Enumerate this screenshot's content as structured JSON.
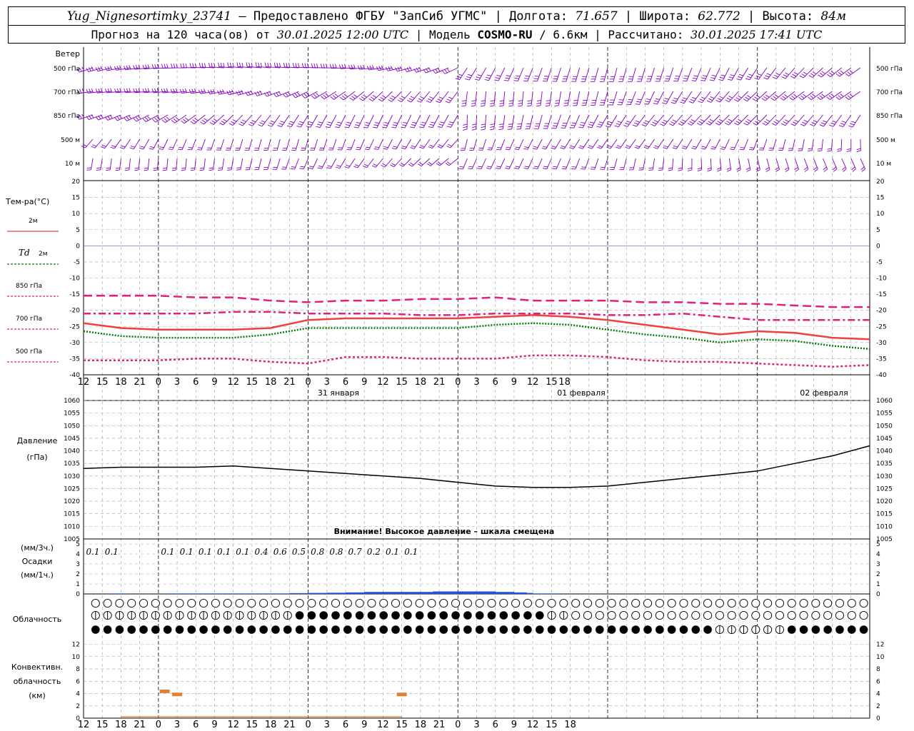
{
  "header": {
    "station": "Yug_Nignesortimky_23741",
    "provided_by": "— Предоставлено ФГБУ \"ЗапСиб УГМС\" | Долгота: ",
    "longitude": "71.657",
    "lat_label": "| Широта: ",
    "latitude": "62.772",
    "alt_label": "| Высота: ",
    "altitude": "84м",
    "forecast_prefix": "Прогноз на 120 часа(ов) от ",
    "forecast_time": "30.01.2025 12:00 UTC",
    "model_prefix": " | Модель ",
    "model_name": "COSMO-RU",
    "model_res": " / 6.6км",
    "calc_prefix": " | Рассчитано: ",
    "calc_time": "30.01.2025 17:41 UTC"
  },
  "labels": {
    "wind": "Ветер",
    "wind_levels": [
      "500 гПа",
      "700 гПа",
      "850 гПа",
      "500 м",
      "10 м"
    ],
    "temp_title": "Тем-ра(°C)",
    "temp_2m": "2м",
    "td_prefix": "Td",
    "td_suffix": "2м",
    "t850": "850 гПа",
    "t700": "700 гПа",
    "t500": "500 гПа",
    "pressure_title": "Давление",
    "pressure_unit": "(гПа)",
    "pressure_warning": "Внимание! Высокое давление – шкала смещена",
    "precip_3h": "(мм/3ч.)",
    "precip_title": "Осадки",
    "precip_1h": "(мм/1ч.)",
    "cloud_title": "Облачность",
    "conv_title": "Конвективн.",
    "conv_sub": "облачность",
    "conv_unit": "(км)"
  },
  "colors": {
    "wind": "#8000c0",
    "t2m": "#f04040",
    "td2m": "#0a7a0a",
    "t850": "#e0207a",
    "t700": "#e0207a",
    "t500": "#e0207a",
    "zero_line": "#4060ff",
    "pressure": "#000000",
    "precip": "#2050e0",
    "conv": "#e08030",
    "grid": "#a0a0a0"
  },
  "chart_data": [
    {
      "type": "line",
      "name": "temperature",
      "x_ticks": [
        "12",
        "15",
        "18",
        "21",
        "0",
        "3",
        "6",
        "9",
        "12",
        "15",
        "18",
        "21",
        "0",
        "3",
        "6",
        "9",
        "12",
        "15",
        "18",
        "21",
        "0",
        "3",
        "6",
        "9",
        "12",
        "15",
        "18"
      ],
      "date_labels": [
        "31 января",
        "01 февраля",
        "02 февраля"
      ],
      "ylim": [
        -40,
        20
      ],
      "y_ticks": [
        20,
        15,
        10,
        5,
        0,
        -5,
        -10,
        -15,
        -20,
        -25,
        -30,
        -35,
        -40
      ],
      "series": [
        {
          "name": "2м",
          "hours": [
            0,
            6,
            12,
            18,
            24,
            30,
            36,
            42,
            48,
            54,
            60,
            66,
            72,
            78,
            84,
            90,
            96,
            102,
            108,
            114,
            120,
            126
          ],
          "values": [
            -24,
            -25.5,
            -26,
            -26,
            -26,
            -25.5,
            -23,
            -22.5,
            -22.5,
            -22.5,
            -22.5,
            -22,
            -21.5,
            -22,
            -23,
            -24.5,
            -26,
            -27.5,
            -26.5,
            -27,
            -28.5,
            -29
          ]
        },
        {
          "name": "Td 2м",
          "hours": [
            0,
            6,
            12,
            18,
            24,
            30,
            36,
            42,
            48,
            54,
            60,
            66,
            72,
            78,
            84,
            90,
            96,
            102,
            108,
            114,
            120,
            126
          ],
          "values": [
            -26.5,
            -28,
            -28.5,
            -28.5,
            -28.5,
            -27.5,
            -25.5,
            -25.5,
            -25.5,
            -25.5,
            -25.5,
            -24.5,
            -24,
            -24.5,
            -26,
            -27.5,
            -28.5,
            -30,
            -29,
            -29.5,
            -31,
            -32
          ]
        },
        {
          "name": "850 гПа",
          "hours": [
            0,
            6,
            12,
            18,
            24,
            30,
            36,
            42,
            48,
            54,
            60,
            66,
            72,
            78,
            84,
            90,
            96,
            102,
            108,
            114,
            120,
            126
          ],
          "values": [
            -15.5,
            -15.5,
            -15.5,
            -16,
            -16,
            -17,
            -17.5,
            -17,
            -17,
            -16.5,
            -16.5,
            -16,
            -17,
            -17,
            -17,
            -17.5,
            -17.5,
            -18,
            -18,
            -18.5,
            -19,
            -19
          ]
        },
        {
          "name": "700 гПа",
          "hours": [
            0,
            6,
            12,
            18,
            24,
            30,
            36,
            42,
            48,
            54,
            60,
            66,
            72,
            78,
            84,
            90,
            96,
            102,
            108,
            114,
            120,
            126
          ],
          "values": [
            -21,
            -21,
            -21,
            -21,
            -20.5,
            -20.5,
            -21,
            -21,
            -21,
            -21.5,
            -21.5,
            -21,
            -21,
            -21,
            -21.5,
            -21.5,
            -21,
            -22,
            -23,
            -23,
            -23,
            -23
          ]
        },
        {
          "name": "500 гПа",
          "hours": [
            0,
            6,
            12,
            18,
            24,
            30,
            36,
            42,
            48,
            54,
            60,
            66,
            72,
            78,
            84,
            90,
            96,
            102,
            108,
            114,
            120,
            126
          ],
          "values": [
            -35.5,
            -35.5,
            -35.5,
            -35,
            -35,
            -36,
            -36.5,
            -34.5,
            -34.5,
            -35,
            -35,
            -35,
            -34,
            -34,
            -34.5,
            -35.5,
            -36,
            -36,
            -36.5,
            -37,
            -37.5,
            -37
          ]
        }
      ]
    },
    {
      "type": "line",
      "name": "pressure",
      "ylim": [
        1005,
        1060
      ],
      "y_ticks": [
        1060,
        1055,
        1050,
        1045,
        1040,
        1035,
        1030,
        1025,
        1020,
        1015,
        1010,
        1005
      ],
      "hours": [
        0,
        6,
        12,
        18,
        24,
        30,
        36,
        42,
        48,
        54,
        60,
        66,
        72,
        78,
        84,
        90,
        96,
        102,
        108,
        114,
        120,
        126
      ],
      "values": [
        1033,
        1033.5,
        1033.5,
        1033.5,
        1034,
        1033,
        1032,
        1031,
        1030,
        1029,
        1027.5,
        1026,
        1025.5,
        1025.5,
        1026,
        1027.5,
        1029,
        1030.5,
        1032,
        1035,
        1038,
        1042
      ]
    },
    {
      "type": "bar",
      "name": "precipitation",
      "ylim": [
        0,
        5
      ],
      "y_ticks": [
        5,
        4,
        3,
        2,
        1,
        0
      ],
      "labels_3h": [
        {
          "hour": 3,
          "text": "0.1"
        },
        {
          "hour": 6,
          "text": "0.1"
        },
        {
          "hour": 15,
          "text": "0.1"
        },
        {
          "hour": 18,
          "text": "0.1"
        },
        {
          "hour": 21,
          "text": "0.1"
        },
        {
          "hour": 24,
          "text": "0.1"
        },
        {
          "hour": 27,
          "text": "0.1"
        },
        {
          "hour": 30,
          "text": "0.4"
        },
        {
          "hour": 33,
          "text": "0.6"
        },
        {
          "hour": 36,
          "text": "0.5"
        },
        {
          "hour": 39,
          "text": "0.8"
        },
        {
          "hour": 42,
          "text": "0.8"
        },
        {
          "hour": 45,
          "text": "0.7"
        },
        {
          "hour": 48,
          "text": "0.2"
        },
        {
          "hour": 51,
          "text": "0.1"
        },
        {
          "hour": 54,
          "text": "0.1"
        }
      ],
      "hourly_mm": [
        0,
        0,
        0,
        0,
        0.05,
        0.05,
        0.05,
        0,
        0,
        0,
        0,
        0,
        0,
        0.05,
        0.05,
        0.05,
        0.05,
        0.05,
        0.05,
        0.05,
        0.05,
        0.05,
        0.05,
        0.05,
        0.05,
        0.05,
        0.05,
        0.05,
        0.05,
        0.05,
        0.05,
        0.05,
        0.05,
        0.08,
        0.08,
        0.08,
        0.1,
        0.1,
        0.1,
        0.12,
        0.12,
        0.12,
        0.15,
        0.15,
        0.15,
        0.2,
        0.2,
        0.2,
        0.2,
        0.2,
        0.2,
        0.2,
        0.2,
        0.2,
        0.2,
        0.2,
        0.25,
        0.25,
        0.25,
        0.25,
        0.25,
        0.25,
        0.25,
        0.25,
        0.25,
        0.25,
        0.2,
        0.2,
        0.2,
        0.15,
        0.15,
        0.1,
        0.05,
        0.05,
        0.05,
        0.05,
        0,
        0,
        0,
        0,
        0,
        0,
        0,
        0,
        0,
        0,
        0,
        0,
        0,
        0,
        0,
        0,
        0,
        0,
        0,
        0,
        0,
        0,
        0,
        0,
        0,
        0,
        0,
        0,
        0,
        0,
        0,
        0,
        0,
        0,
        0,
        0,
        0,
        0,
        0,
        0,
        0,
        0,
        0,
        0,
        0,
        0,
        0,
        0,
        0,
        0,
        0
      ]
    },
    {
      "type": "table",
      "name": "cloudiness",
      "note": "cloud cover symbols per hour: 0=clear,1=partial,2=overcast",
      "rows": {
        "high": "000000000000000000000000000000000000000000000000000000000000000000000000000000000000000000000000000000000000000000000000000000000000",
        "middle": "111111111111111111111111111111111111222222222222222222222222222222222222222222111100000000000000000000000000000000000000000000000000",
        "low": "222222222222222222222222222222222222222222222222222222222222222222222222222222222222222222222222222222222211121212111122222222222222"
      }
    },
    {
      "type": "bar",
      "name": "convective_cloud",
      "ylim": [
        0,
        13
      ],
      "y_ticks": [
        12,
        10,
        8,
        6,
        4,
        2,
        0
      ],
      "cells": [
        {
          "hour": 13,
          "top_km": 4.3
        },
        {
          "hour": 15,
          "top_km": 3.8
        },
        {
          "hour": 51,
          "top_km": 3.8
        }
      ],
      "base_line_hours": [
        15,
        33
      ]
    }
  ]
}
